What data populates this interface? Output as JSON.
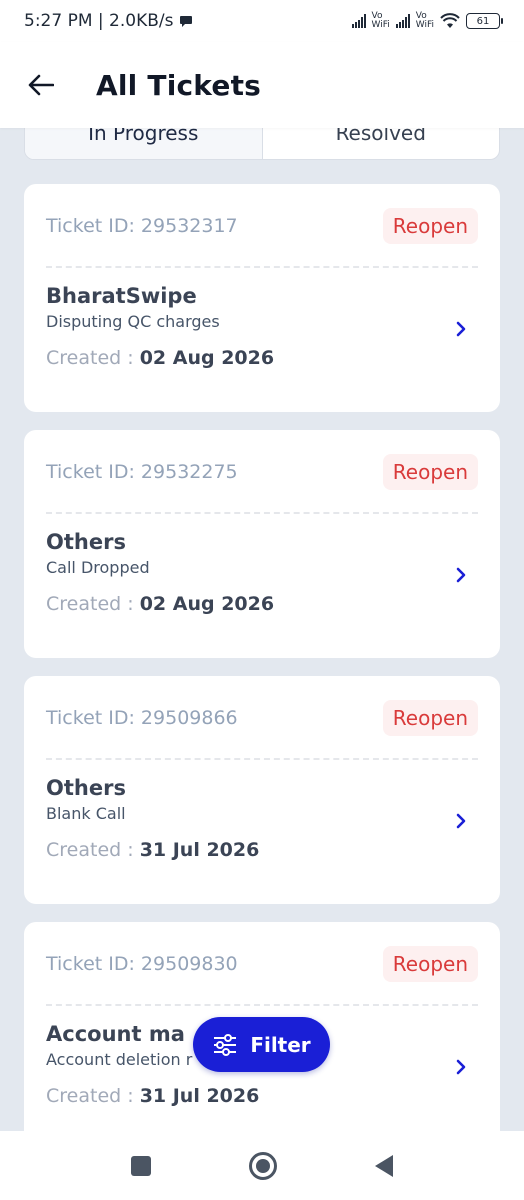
{
  "status_bar": {
    "time": "5:27 PM | 2.0KB/s",
    "vo_wifi_1_top": "Vo",
    "vo_wifi_1_bottom": "WiFi",
    "vo_wifi_2_top": "Vo",
    "vo_wifi_2_bottom": "WiFi",
    "battery": "61"
  },
  "header": {
    "title": "All Tickets"
  },
  "tabs": [
    {
      "label": "In Progress",
      "active": true
    },
    {
      "label": "Resolved",
      "active": false
    }
  ],
  "tickets": [
    {
      "id_label": "Ticket ID: 29532317",
      "badge": "Reopen",
      "category": "BharatSwipe",
      "issue": "Disputing QC charges",
      "created_label": "Created : ",
      "created_date": "02 Aug 2026"
    },
    {
      "id_label": "Ticket ID: 29532275",
      "badge": "Reopen",
      "category": "Others",
      "issue": "Call Dropped",
      "created_label": "Created : ",
      "created_date": "02 Aug 2026"
    },
    {
      "id_label": "Ticket ID: 29509866",
      "badge": "Reopen",
      "category": "Others",
      "issue": "Blank Call",
      "created_label": "Created : ",
      "created_date": "31 Jul 2026"
    },
    {
      "id_label": "Ticket ID: 29509830",
      "badge": "Reopen",
      "category": "Account ma",
      "issue": "Account deletion r",
      "created_label": "Created : ",
      "created_date": "31 Jul 2026"
    }
  ],
  "filter": {
    "label": "Filter"
  },
  "colors": {
    "accent": "#1a1fd6",
    "badge_text": "#d93b3b",
    "badge_bg": "#fdf0f0",
    "background": "#e3e8ef"
  }
}
